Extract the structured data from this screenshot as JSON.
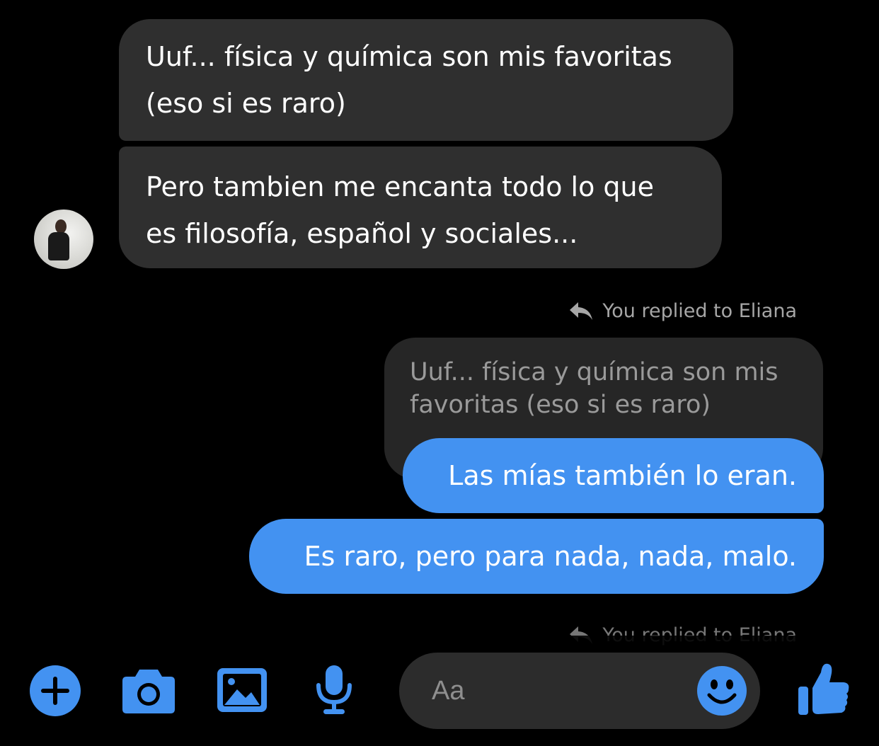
{
  "messages": {
    "incoming": [
      {
        "lines": [
          "Uuf... física y química son mis favoritas",
          "(eso si es raro)"
        ]
      },
      {
        "lines": [
          "Pero tambien me encanta todo lo que",
          "es filosofía, español y sociales..."
        ]
      }
    ],
    "reply_label": "You replied to Eliana",
    "quoted": {
      "lines": [
        "Uuf... física y química son mis",
        "favoritas (eso si es raro)"
      ]
    },
    "outgoing": [
      {
        "text": "Las mías también lo eran."
      },
      {
        "text": "Es raro, pero para nada, nada, malo."
      }
    ],
    "reply_label_partial": "You replied to Eliana"
  },
  "composer": {
    "placeholder": "Aa",
    "icons": [
      "plus-icon",
      "camera-icon",
      "image-icon",
      "microphone-icon",
      "emoji-icon",
      "thumbs-up-icon"
    ]
  },
  "colors": {
    "background": "#000000",
    "incoming_bubble": "#2f2f2f",
    "outgoing_bubble": "#4392f1",
    "accent": "#4392f1",
    "muted_text": "#a6a6a6"
  }
}
